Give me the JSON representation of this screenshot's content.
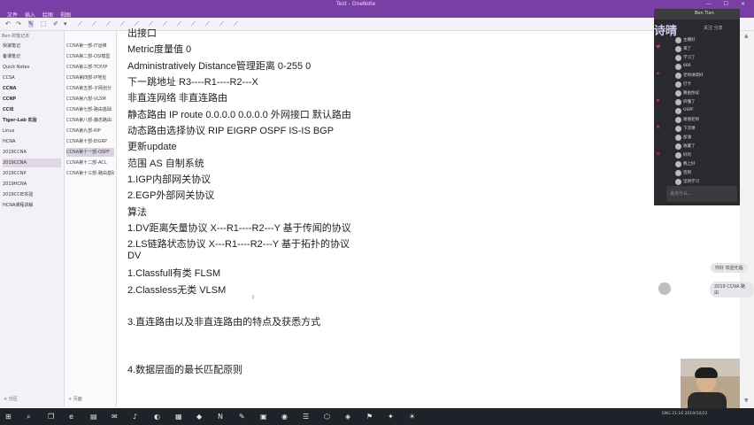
{
  "window": {
    "title": "Test - OneNote",
    "controls": "— ☐ ✕"
  },
  "ribbon": {
    "tabs": [
      "文件",
      "插入",
      "绘图",
      "视图"
    ]
  },
  "toolbar": {
    "icons": [
      "↶",
      "↷",
      "✎",
      "⬚",
      "✐",
      "▾",
      "⟋",
      "⟋",
      "⟋",
      "⟋",
      "⟋",
      "⟋",
      "⟋",
      "⟋",
      "⟋",
      "⟋",
      "⟋",
      "⟋"
    ]
  },
  "notebook": {
    "header": "Ben 的笔记本",
    "sections": [
      "快速笔记",
      "备课笔记",
      "Quick Notes",
      "CCSA",
      "CCNA",
      "CCNP",
      "CCIE",
      "Tiger-Lab 实验",
      "Linux",
      "HCNA",
      "2019CCNA",
      "2019CCNA",
      "2019CCNP",
      "2019HCNA",
      "2019CCIE实验",
      "HCNA课程讲解"
    ],
    "add_section": "+ 分区"
  },
  "pages": {
    "items": [
      "CCNA第一部-IT运维",
      "CCNA第二部-OSI模型",
      "CCNA第三部-TCP/IP",
      "CCNA第四部-IP地址",
      "CCNA第五部-子网划分",
      "CCNA第六部-VLSM",
      "CCNA第七部-路由基础",
      "CCNA第八部-静态路由",
      "CCNA第九部-RIP",
      "CCNA第十部-EIGRP",
      "CCNA第十一部-OSPF",
      "CCNA第十二部-ACL",
      "CCNA第十三部-路由基础"
    ],
    "add_page": "+ 页面"
  },
  "note": {
    "lines": [
      "出接口",
      "Metric度量值 0",
      "Administratively Distance管理距离 0-255 0",
      "下一跳地址          R3----R1----R2---X",
      "非直连网络  非直连路由",
      "静态路由  IP route 0.0.0.0 0.0.0.0 外网接口 默认路由",
      "动态路由选择协议 RIP EIGRP OSPF IS-IS BGP",
      "更新update",
      "范围  AS 自制系统",
      "1.IGP内部网关协议",
      "2.EGP外部网关协议",
      "算法",
      "1.DV距离矢量协议     X---R1----R2---Y 基于传闻的协议",
      "2.LS链路状态协议  X---R1----R2---Y  基于拓扑的协议",
      "DV",
      "1.Classfull有类  FLSM",
      "2.Classless无类  VLSM",
      "3.直连路由以及非直连路由的特点及获悉方式",
      "4.数据层面的最长匹配原则"
    ]
  },
  "chat": {
    "title": "Ben Tian",
    "banner": "诗晴",
    "actions": "关注 分享",
    "messages": [
      "主播好",
      "来了",
      "学习了",
      "666",
      "老师讲得好",
      "打卡",
      "路由协议",
      "听懂了",
      "OSPF",
      "谢谢老师",
      "下次课",
      "加油",
      "收藏了",
      "好的",
      "晚上好",
      "签到",
      "坚持学习"
    ],
    "input_placeholder": "说点什么…"
  },
  "bubbles": [
    "你好 欢迎光临",
    "2019 CCNA 路由"
  ],
  "taskbar": {
    "icons": [
      "⊞",
      "⌕",
      "❐",
      "e",
      "▤",
      "✉",
      "♪",
      "◐",
      "▦",
      "◆",
      "N",
      "✎",
      "▣",
      "◉",
      "☰",
      "⬡",
      "◈",
      "⚑",
      "✦",
      "☀"
    ],
    "tray_text": "ENG  21:16  2019/10/22"
  }
}
